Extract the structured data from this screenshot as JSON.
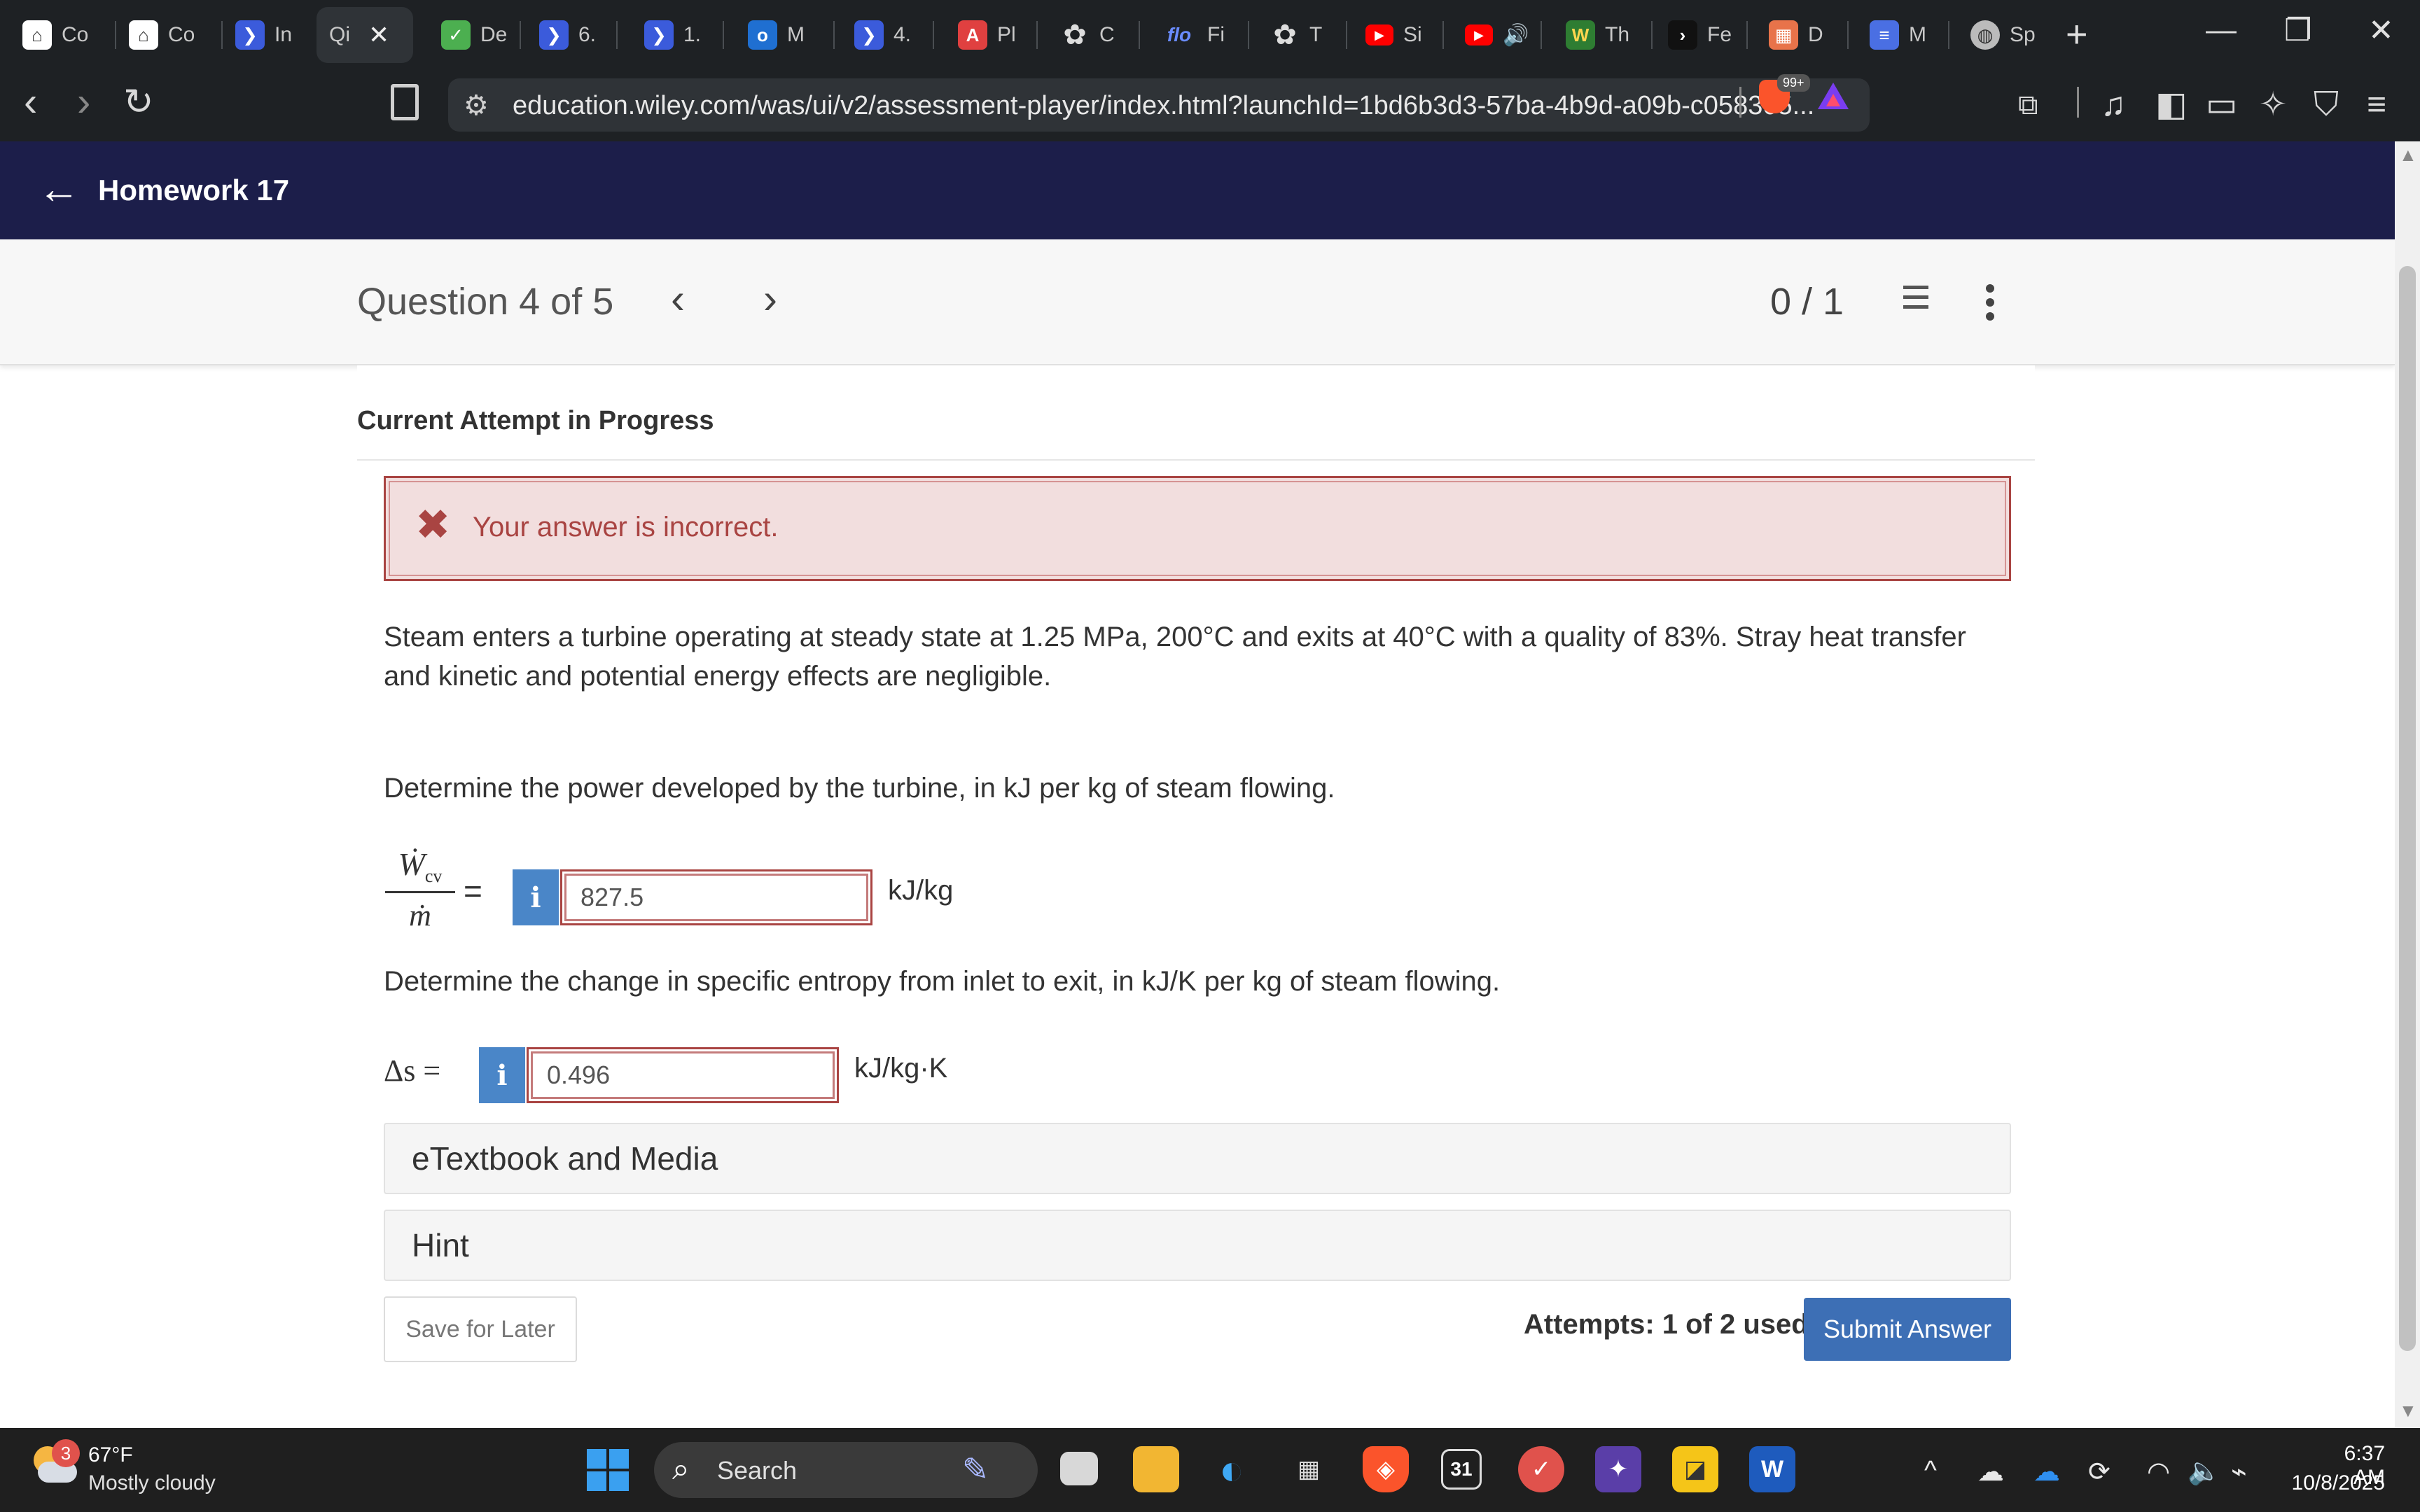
{
  "browser": {
    "tabs": [
      {
        "label": "Co",
        "icon": "library-icon",
        "color": "#ffffff"
      },
      {
        "label": "Co",
        "icon": "library-icon",
        "color": "#ffffff"
      },
      {
        "label": "In",
        "icon": "bookmark-blue-icon",
        "color": "#3b5bdb"
      },
      {
        "label": "Qi",
        "icon": "none",
        "color": "#2f3337",
        "active": true
      },
      {
        "label": "De",
        "icon": "check-green-icon",
        "color": "#4caf50"
      },
      {
        "label": "6.",
        "icon": "bookmark-blue-icon",
        "color": "#3b5bdb"
      },
      {
        "label": "1.",
        "icon": "bookmark-blue-icon",
        "color": "#3b5bdb"
      },
      {
        "label": "M",
        "icon": "outlook-icon",
        "color": "#1f6fd1"
      },
      {
        "label": "4.",
        "icon": "bookmark-blue-icon",
        "color": "#3b5bdb"
      },
      {
        "label": "Pl",
        "icon": "a-red-icon",
        "color": "#e04040"
      },
      {
        "label": "C",
        "icon": "openai-icon",
        "color": "#444444"
      },
      {
        "label": "Fi",
        "icon": "flo-icon",
        "color": "#1e2124"
      },
      {
        "label": "T",
        "icon": "openai-icon",
        "color": "#444444"
      },
      {
        "label": "Si",
        "icon": "youtube-icon",
        "color": "#ff0000"
      },
      {
        "label": "",
        "icon": "youtube-icon",
        "color": "#ff0000",
        "audio": true
      },
      {
        "label": "Th",
        "icon": "w-shield-icon",
        "color": "#2e7d32"
      },
      {
        "label": "Fe",
        "icon": "play-icon",
        "color": "#111111"
      },
      {
        "label": "D",
        "icon": "calendar-grid-icon",
        "color": "#e8734a"
      },
      {
        "label": "M",
        "icon": "docs-icon",
        "color": "#4a6fe3"
      },
      {
        "label": "Sp",
        "icon": "globe-icon",
        "color": "#bbbbbb"
      }
    ],
    "new_tab": "+",
    "minimize": "—",
    "restore": "❐",
    "close": "✕",
    "url": "education.wiley.com/was/ui/v2/assessment-player/index.html?launchId=1bd6b3d3-57ba-4b9d-a09b-c058305...",
    "brave_badge": "99+"
  },
  "header": {
    "title": "Homework 17"
  },
  "question_bar": {
    "title": "Question 4 of 5",
    "score": "0 / 1"
  },
  "main": {
    "attempt_heading": "Current Attempt in Progress",
    "alert": "Your answer is incorrect.",
    "problem": "Steam enters a turbine operating at steady state at 1.25 MPa, 200°C and exits at 40°C with a quality of 83%. Stray heat transfer and kinetic and potential energy effects are negligible.",
    "part1": {
      "prompt": "Determine the power developed by the turbine, in kJ per kg of steam flowing.",
      "lhs_num": "Ẇ",
      "lhs_sub": "cv",
      "lhs_den": "ṁ",
      "equals": "=",
      "info": "i",
      "value": "827.5",
      "unit": "kJ/kg"
    },
    "part2": {
      "prompt": "Determine the change in specific entropy from inlet to exit, in kJ/K per kg of steam flowing.",
      "lhs": "Δs =",
      "info": "i",
      "value": "0.496",
      "unit": "kJ/kg·K"
    },
    "etextbook": "eTextbook and Media",
    "hint": "Hint",
    "save_label": "Save for Later",
    "attempts": "Attempts: 1 of 2 used",
    "submit_label": "Submit Answer"
  },
  "taskbar": {
    "weather_badge": "3",
    "temp": "67°F",
    "weather": "Mostly cloudy",
    "search_placeholder": "Search",
    "time": "6:37 AM",
    "date": "10/8/2025"
  }
}
